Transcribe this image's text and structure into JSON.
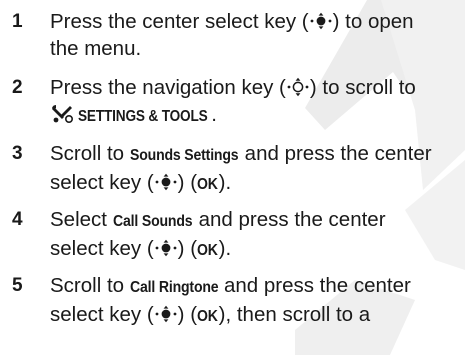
{
  "watermark_color": "#e9e9e9",
  "icons": {
    "select_key": "center-select-key-icon",
    "navigation_key": "navigation-key-icon",
    "settings": "settings-tools-icon"
  },
  "steps": [
    {
      "number": "1",
      "line1_pre": "Press the center select key (",
      "line1_post": ") to open",
      "line2": "the menu."
    },
    {
      "number": "2",
      "line1_pre": "Press the navigation key (",
      "line1_post": ") to scroll to",
      "keyword": "SETTINGS & TOOLS",
      "line2_post": "."
    },
    {
      "number": "3",
      "line1_pre": "Scroll to ",
      "keyword": "Sounds Settings",
      "line1_post": " and press the center",
      "line2_pre": "select key (",
      "line2_mid": ") (",
      "ok": "OK",
      "line2_post": ")."
    },
    {
      "number": "4",
      "line1_pre": "Select ",
      "keyword": "Call Sounds",
      "line1_post": " and press the center",
      "line2_pre": "select key (",
      "line2_mid": ") (",
      "ok": "OK",
      "line2_post": ")."
    },
    {
      "number": "5",
      "line1_pre": "Scroll to ",
      "keyword": "Call Ringtone",
      "line1_post": " and press the center",
      "line2_pre": "select key (",
      "line2_mid": ") (",
      "ok": "OK",
      "line2_post": "), then scroll to a"
    }
  ]
}
